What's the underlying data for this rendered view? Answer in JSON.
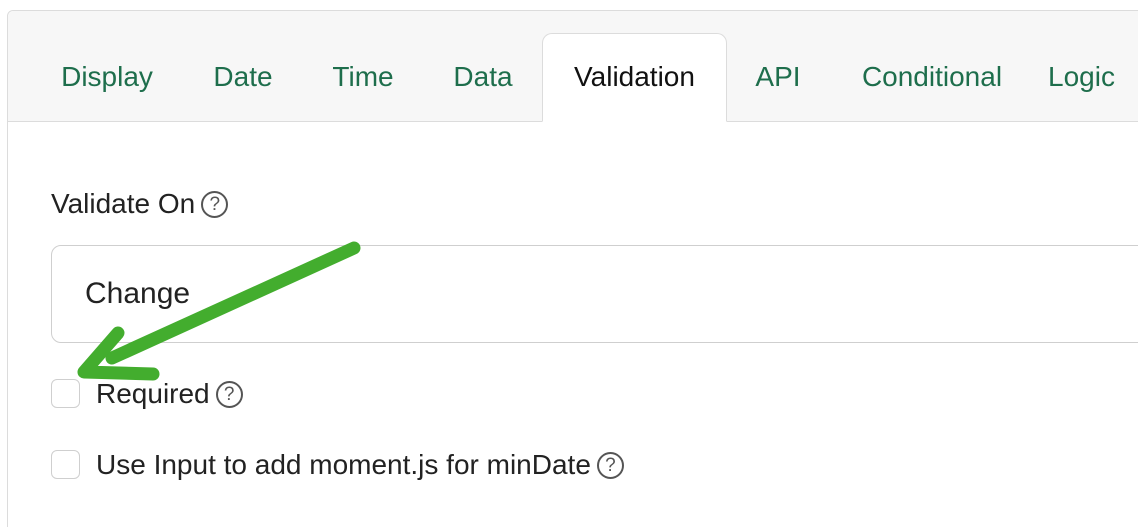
{
  "tabs": [
    {
      "label": "Display",
      "active": false
    },
    {
      "label": "Date",
      "active": false
    },
    {
      "label": "Time",
      "active": false
    },
    {
      "label": "Data",
      "active": false
    },
    {
      "label": "Validation",
      "active": true
    },
    {
      "label": "API",
      "active": false
    },
    {
      "label": "Conditional",
      "active": false
    },
    {
      "label": "Logic",
      "active": false
    }
  ],
  "validate_on": {
    "label": "Validate On",
    "help": "?",
    "value": "Change"
  },
  "required": {
    "label": "Required",
    "help": "?",
    "checked": false
  },
  "moment_input": {
    "label": "Use Input to add moment.js for minDate",
    "help": "?",
    "checked": false
  },
  "colors": {
    "tab_text": "#1e6e4c",
    "active_tab_text": "#111111",
    "annotation_arrow": "#43ad2e"
  }
}
